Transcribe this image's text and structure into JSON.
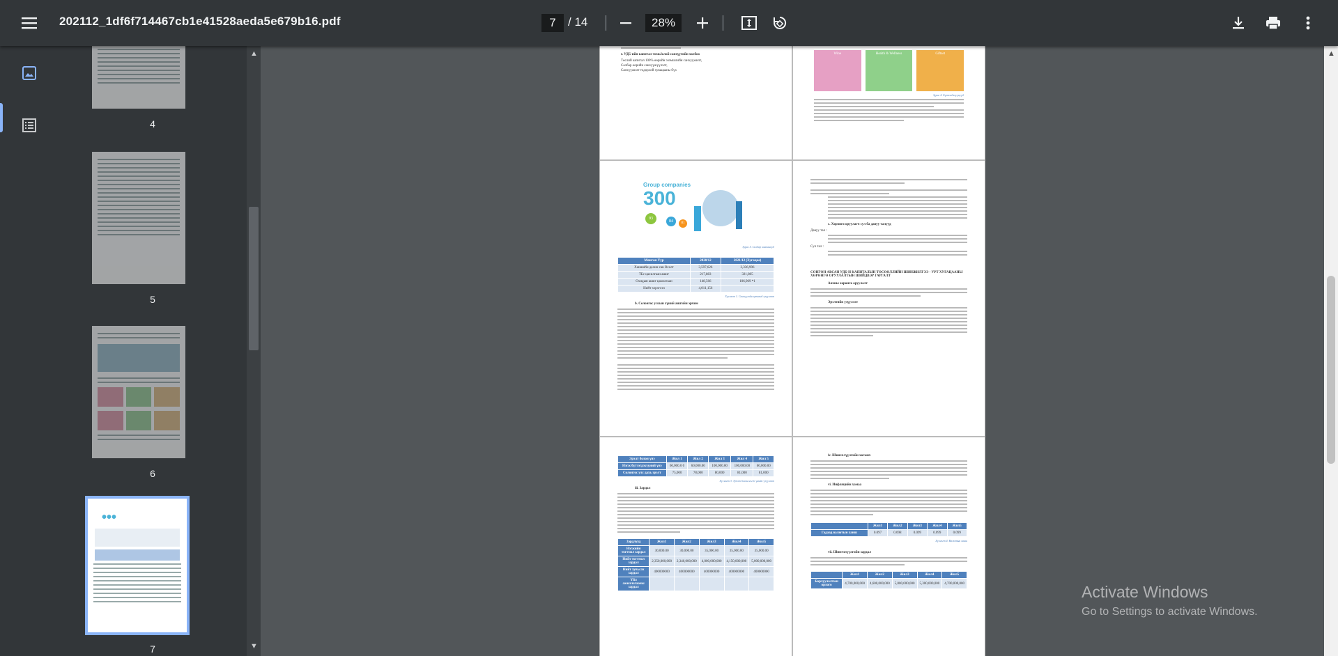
{
  "document": {
    "filename": "202112_1df6f714467cb1e41528aeda5e679b16.pdf",
    "current_page": "7",
    "total_pages": "/ 14",
    "zoom": "28%"
  },
  "toolbar_icons": [
    "menu-icon",
    "zoom-out-icon",
    "zoom-in-icon",
    "fit-page-icon",
    "rotate-icon",
    "download-icon",
    "print-icon",
    "more-icon"
  ],
  "sidebar": {
    "thumbnails": [
      {
        "page": "4",
        "selected": false
      },
      {
        "page": "5",
        "selected": false
      },
      {
        "page": "6",
        "selected": false
      },
      {
        "page": "7",
        "selected": true
      }
    ]
  },
  "pages": {
    "p1_left": {
      "heading": "г. УДБ-ийн капитал томьёолой санхүүгийн холбоо",
      "bullets": [
        "Төслий капитал 100% өөрийн эзэмшлийн санхүүжилт,",
        "Салбар өөрийн санхүүжүүлэлт,",
        "Санхүүжилт тодорхой хувьцааны бүх"
      ]
    },
    "p2_left": {
      "graphic_title": "Group companies",
      "graphic_number": "300",
      "bubbles": [
        "93",
        "84",
        "81"
      ],
      "caption": "Зураг 5. Салбар компаниуд",
      "table": {
        "headers": [
          "Мянган Үүр",
          "2020/12",
          "2021/12 (Хугацаа)"
        ],
        "rows": [
          [
            "Ханшийн дахин сав Өсөлт",
            "3,597,626",
            "3,336,996"
          ],
          [
            "ТБс цахилгаан ашиг",
            "217,883",
            "321,805"
          ],
          [
            "Охидын ашиг цахилгаан",
            "148,566",
            "106,969 *1"
          ],
          [
            "Нийт хэрэгсэл",
            "4,011,156",
            ""
          ]
        ]
      },
      "table_caption": "Хүснэгт 1. Санхүүгийн ерөнхий үзүүлэлт",
      "section": "b. Солонгос улсын хүний ашгийн эрчим"
    },
    "p2_right": {
      "section_a": "c. Хөрөнгө оруулагч сул ба давуу талууд",
      "sub_pros": "Давуу тал :",
      "sub_cons": "Сул тал :",
      "title_caps": "СОНГОН АВСАН УДБ-Н КАПИТАЛЫН ТӨСӨӨЛЛИЙН ШИНЖИЛГЭЭ - УРТ ХУГАЦААНЫ ХӨРӨНГӨ ОРУУЛАЛТЫН ШИЙДВЭР ГАРГАЛТ",
      "item_i": "Анхны хөрөнгө оруулалт",
      "item_ii": "Эрэлтийн үзүүлэлт"
    },
    "p3_left": {
      "table1": {
        "headers": [
          "Эрэлт болон үнэ",
          "Жил 1",
          "Жил 2",
          "Жил 3",
          "Жил 4",
          "Жил 5"
        ],
        "rows": [
          [
            "Нэгж бүтээгдэхүүний үнэ",
            "60,000.0 0",
            "60,000.00",
            "100,000.00",
            "100,000.00",
            "60,000.00"
          ],
          [
            "Солонгос улс дахь эрэлт",
            "75,000",
            "78,000",
            "80,000",
            "81,000",
            "81,000"
          ]
        ]
      },
      "table1_caption": "Хүснэгт 3. Эрэлт болон нэгж үнийн үзүүлэлт",
      "section": "iii. Зардал",
      "table2": {
        "headers": [
          "Зардлууд",
          "Жил1",
          "Жил2",
          "Жил3",
          "Жил4",
          "Жил5"
        ],
        "rows": [
          [
            "Нэгжийн тогтмол зардал",
            "30,000.00",
            "30,000.00",
            "35,000.00",
            "35,000.00",
            "35,000.00"
          ],
          [
            "Нийт тогтмол зардал",
            "2,350,000,000",
            "2,340,000,000",
            "4,000,000,000",
            "4,150,000,000",
            "5,000,000,000"
          ],
          [
            "Нийт хувьсах зардал",
            "400000000",
            "400000000",
            "400000000",
            "400000000",
            "400000000"
          ],
          [
            "Үйл ажиллагааны зардал",
            "",
            "",
            "",
            "",
            ""
          ]
        ]
      }
    },
    "p3_right": {
      "item_a": "iv. Шинэчлүүлгийн хөгжих",
      "item_b": "vi. Инфляцийн хамаа",
      "table": {
        "headers": [
          "",
          "Жил1",
          "Жил2",
          "Жил3",
          "Жил4",
          "Жил5"
        ],
        "rows": [
          [
            "Гадаад валютын ханш",
            "0.097",
            "0.098",
            "0.099",
            "0.099",
            "0.099"
          ]
        ]
      },
      "caption": "Хүснэгт 4. Валютын ханш",
      "item_c": "vii. Шинэчлүүлгийн зардал",
      "table2": {
        "headers": [
          "",
          "Жил1",
          "Жил2",
          "Жил3",
          "Жил4",
          "Жил5"
        ],
        "rows": [
          [
            "Борлуулалтын орлого",
            "4,700,000,000",
            "4,600,000,000",
            "5,000,000,000",
            "5,300,000,000",
            "4,700,000,000"
          ]
        ]
      }
    },
    "p1_right": {
      "panels": [
        "Wine",
        "Health & Wellness",
        "Giftset"
      ],
      "caption": "Зураг 4. Бүтээгдэхүүнүүд"
    }
  },
  "watermark": {
    "line1": "Activate Windows",
    "line2": "Go to Settings to activate Windows."
  },
  "colors": {
    "toolbar": "#323639",
    "viewer_bg": "#525659",
    "accent": "#8ab4f8",
    "table_header": "#4f81bd"
  }
}
